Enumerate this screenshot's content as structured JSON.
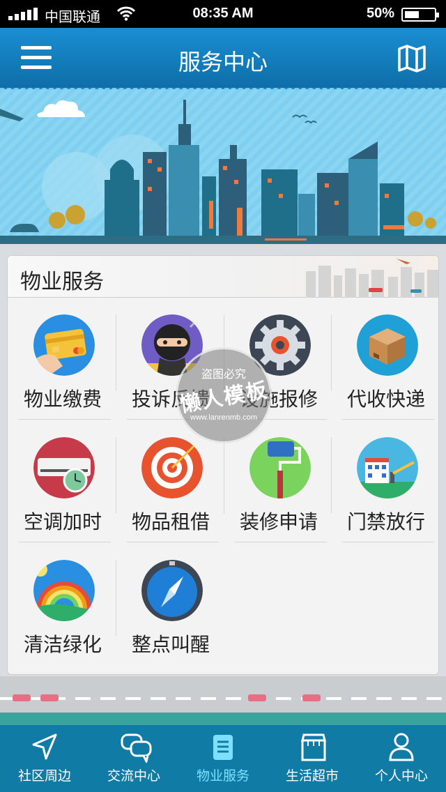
{
  "status_bar": {
    "carrier": "中国联通",
    "time": "08:35 AM",
    "battery_text": "50%",
    "battery_level": 0.5
  },
  "header": {
    "title": "服务中心",
    "menu_icon": "hamburger-menu-icon",
    "map_icon": "map-icon"
  },
  "section": {
    "title": "物业服务"
  },
  "services": [
    {
      "label": "物业缴费",
      "icon": "credit-card-icon"
    },
    {
      "label": "投诉反馈",
      "icon": "ninja-icon"
    },
    {
      "label": "设施报修",
      "icon": "gear-icon"
    },
    {
      "label": "代收快递",
      "icon": "package-box-icon"
    },
    {
      "label": "空调加时",
      "icon": "air-conditioner-clock-icon"
    },
    {
      "label": "物品租借",
      "icon": "target-dart-icon"
    },
    {
      "label": "装修申请",
      "icon": "paint-roller-icon"
    },
    {
      "label": "门禁放行",
      "icon": "gate-barrier-icon"
    },
    {
      "label": "清洁绿化",
      "icon": "rainbow-icon"
    },
    {
      "label": "整点叫醒",
      "icon": "compass-icon"
    }
  ],
  "watermark": {
    "line1": "盗图必究",
    "line2": "懒人模板",
    "line3": "www.lanrenmb.com"
  },
  "tabs": [
    {
      "label": "社区周边",
      "icon": "location-arrow-icon",
      "active": false
    },
    {
      "label": "交流中心",
      "icon": "chat-bubbles-icon",
      "active": false
    },
    {
      "label": "物业服务",
      "icon": "document-icon",
      "active": true
    },
    {
      "label": "生活超市",
      "icon": "shop-icon",
      "active": false
    },
    {
      "label": "个人中心",
      "icon": "person-icon",
      "active": false
    }
  ],
  "colors": {
    "header_blue": "#1a8ed2",
    "tab_bar": "#107ba4",
    "active_tab": "#7ee0ff",
    "sky": "#7fd0f0"
  }
}
